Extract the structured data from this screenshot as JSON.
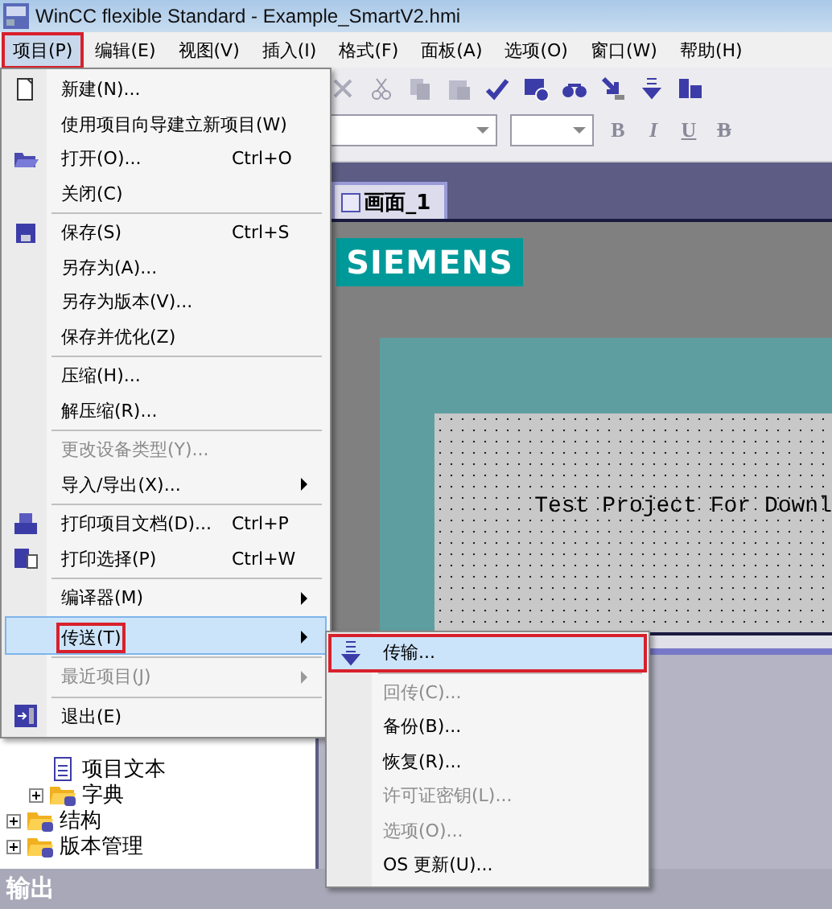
{
  "window": {
    "title": "WinCC flexible Standard - Example_SmartV2.hmi"
  },
  "menubar": [
    {
      "label": "项目(P)",
      "selected": true,
      "marked": true
    },
    {
      "label": "编辑(E)",
      "selected": false,
      "marked": false
    },
    {
      "label": "视图(V)",
      "selected": false,
      "marked": false
    },
    {
      "label": "插入(I)",
      "selected": false,
      "marked": false
    },
    {
      "label": "格式(F)",
      "selected": false,
      "marked": false
    },
    {
      "label": "面板(A)",
      "selected": false,
      "marked": false
    },
    {
      "label": "选项(O)",
      "selected": false,
      "marked": false
    },
    {
      "label": "窗口(W)",
      "selected": false,
      "marked": false
    },
    {
      "label": "帮助(H)",
      "selected": false,
      "marked": false
    }
  ],
  "project_menu": [
    {
      "label": "新建(N)...",
      "separator_before": false,
      "disabled": false,
      "submenu": false,
      "selected": false,
      "marked": false
    },
    {
      "label": "使用项目向导建立新项目(W)",
      "separator_before": false,
      "disabled": false,
      "submenu": false,
      "selected": false,
      "marked": false
    },
    {
      "label": "打开(O)...",
      "shortcut": "Ctrl+O",
      "separator_before": false,
      "disabled": false,
      "submenu": false,
      "selected": false,
      "marked": false
    },
    {
      "label": "关闭(C)",
      "separator_before": false,
      "disabled": false,
      "submenu": false,
      "selected": false,
      "marked": false
    },
    {
      "label": "保存(S)",
      "shortcut": "Ctrl+S",
      "separator_before": true,
      "disabled": false,
      "submenu": false,
      "selected": false,
      "marked": false
    },
    {
      "label": "另存为(A)...",
      "separator_before": false,
      "disabled": false,
      "submenu": false,
      "selected": false,
      "marked": false
    },
    {
      "label": "另存为版本(V)...",
      "separator_before": false,
      "disabled": false,
      "submenu": false,
      "selected": false,
      "marked": false
    },
    {
      "label": "保存并优化(Z)",
      "separator_before": false,
      "disabled": false,
      "submenu": false,
      "selected": false,
      "marked": false
    },
    {
      "label": "压缩(H)...",
      "separator_before": true,
      "disabled": false,
      "submenu": false,
      "selected": false,
      "marked": false
    },
    {
      "label": "解压缩(R)...",
      "separator_before": false,
      "disabled": false,
      "submenu": false,
      "selected": false,
      "marked": false
    },
    {
      "label": "更改设备类型(Y)...",
      "separator_before": true,
      "disabled": true,
      "submenu": false,
      "selected": false,
      "marked": false
    },
    {
      "label": "导入/导出(X)...",
      "separator_before": false,
      "disabled": false,
      "submenu": true,
      "selected": false,
      "marked": false
    },
    {
      "label": "打印项目文档(D)...",
      "shortcut": "Ctrl+P",
      "separator_before": true,
      "disabled": false,
      "submenu": false,
      "selected": false,
      "marked": false
    },
    {
      "label": "打印选择(P)",
      "shortcut": "Ctrl+W",
      "separator_before": false,
      "disabled": false,
      "submenu": false,
      "selected": false,
      "marked": false
    },
    {
      "label": "编译器(M)",
      "separator_before": true,
      "disabled": false,
      "submenu": true,
      "selected": false,
      "marked": false
    },
    {
      "label": "传送(T)",
      "separator_before": true,
      "disabled": false,
      "submenu": true,
      "selected": true,
      "marked": true
    },
    {
      "label": "最近项目(J)",
      "separator_before": true,
      "disabled": true,
      "submenu": true,
      "selected": false,
      "marked": false
    },
    {
      "label": "退出(E)",
      "separator_before": true,
      "disabled": false,
      "submenu": false,
      "selected": false,
      "marked": false
    }
  ],
  "transfer_menu": [
    {
      "label": "传输...",
      "disabled": false,
      "selected": true,
      "marked": true
    },
    {
      "label": "回传(C)...",
      "disabled": true,
      "selected": false,
      "marked": false
    },
    {
      "label": "备份(B)...",
      "disabled": false,
      "selected": false,
      "marked": false
    },
    {
      "label": "恢复(R)...",
      "disabled": false,
      "selected": false,
      "marked": false
    },
    {
      "label": "许可证密钥(L)...",
      "disabled": true,
      "selected": false,
      "marked": false
    },
    {
      "label": "选项(O)...",
      "disabled": true,
      "selected": false,
      "marked": false
    },
    {
      "label": "OS 更新(U)...",
      "disabled": false,
      "selected": false,
      "marked": false
    }
  ],
  "format_toolbar": {
    "bold": "B",
    "italic": "I",
    "underline": "U",
    "strike": "B"
  },
  "tree": {
    "items": [
      {
        "children": [
          {
            "label": "项目文本",
            "kind": "document"
          },
          {
            "label": "字典",
            "kind": "folder",
            "expanded": false
          }
        ]
      },
      {
        "label": "结构",
        "kind": "folder",
        "expanded": false
      },
      {
        "label": "版本管理",
        "kind": "folder",
        "expanded": false
      }
    ]
  },
  "editor": {
    "tabs": [
      {
        "label": "画面_1",
        "selected": true
      }
    ],
    "logo": "SIEMENS",
    "screen_text": "Test Project For Downl"
  },
  "output_panel": {
    "title": "输出"
  }
}
